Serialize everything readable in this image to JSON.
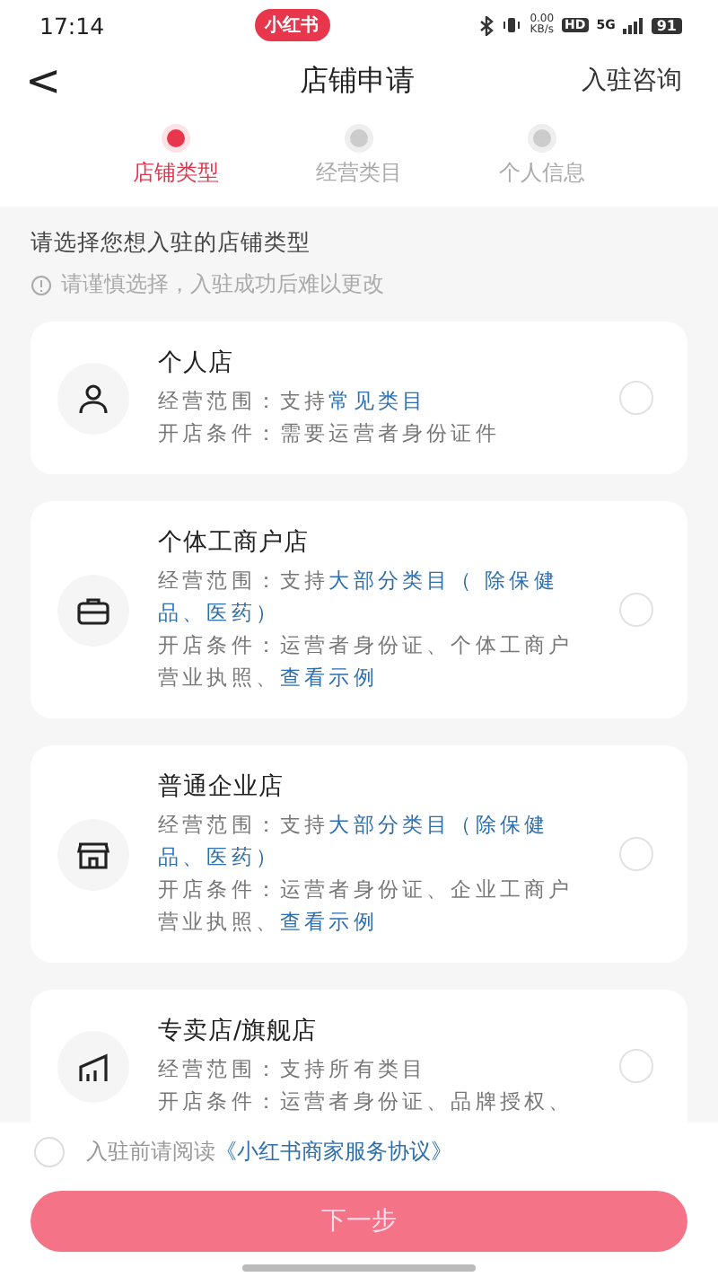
{
  "status_bar": {
    "time": "17:14",
    "app_badge": "小红书",
    "net_speed": "0.00",
    "net_unit": "KB/s",
    "hd": "HD",
    "network": "5G",
    "battery": "91"
  },
  "header": {
    "back": "<",
    "title": "店铺申请",
    "action": "入驻咨询"
  },
  "steps": [
    {
      "label": "店铺类型",
      "selected": true
    },
    {
      "label": "经营类目",
      "selected": false
    },
    {
      "label": "个人信息",
      "selected": false
    }
  ],
  "prompt": "请选择您想入驻的店铺类型",
  "hint": "请谨慎选择，入驻成功后难以更改",
  "shop_types": [
    {
      "title": "个人店",
      "selected": false,
      "lines": [
        [
          {
            "text": "经营范围：支持",
            "kind": "plain"
          },
          {
            "text": "常见类目",
            "kind": "highlight"
          }
        ],
        [
          {
            "text": "开店条件：需要运营者身份证件",
            "kind": "plain"
          }
        ]
      ]
    },
    {
      "title": "个体工商户店",
      "selected": false,
      "lines": [
        [
          {
            "text": "经营范围：支持",
            "kind": "plain"
          },
          {
            "text": "大部分类目（ 除保健品、医药）",
            "kind": "highlight"
          }
        ],
        [
          {
            "text": "开店条件：运营者身份证、个体工商户营业执照、",
            "kind": "plain"
          },
          {
            "text": "查看示例",
            "kind": "link"
          }
        ]
      ]
    },
    {
      "title": "普通企业店",
      "selected": false,
      "lines": [
        [
          {
            "text": "经营范围：支持",
            "kind": "plain"
          },
          {
            "text": "大部分类目（除保健品、医药）",
            "kind": "highlight"
          }
        ],
        [
          {
            "text": "开店条件：运营者身份证、企业工商户营业执照、",
            "kind": "plain"
          },
          {
            "text": "查看示例",
            "kind": "link"
          }
        ]
      ]
    },
    {
      "title": "专卖店/旗舰店",
      "selected": false,
      "lines": [
        [
          {
            "text": "经营范围：支持所有类目",
            "kind": "plain"
          }
        ],
        [
          {
            "text": "开店条件：运营者身份证、品牌授权、",
            "kind": "plain"
          }
        ]
      ]
    }
  ],
  "agreement": {
    "checked": false,
    "text": "入驻前请阅读",
    "link": "《小红书商家服务协议》"
  },
  "next_button": "下一步"
}
